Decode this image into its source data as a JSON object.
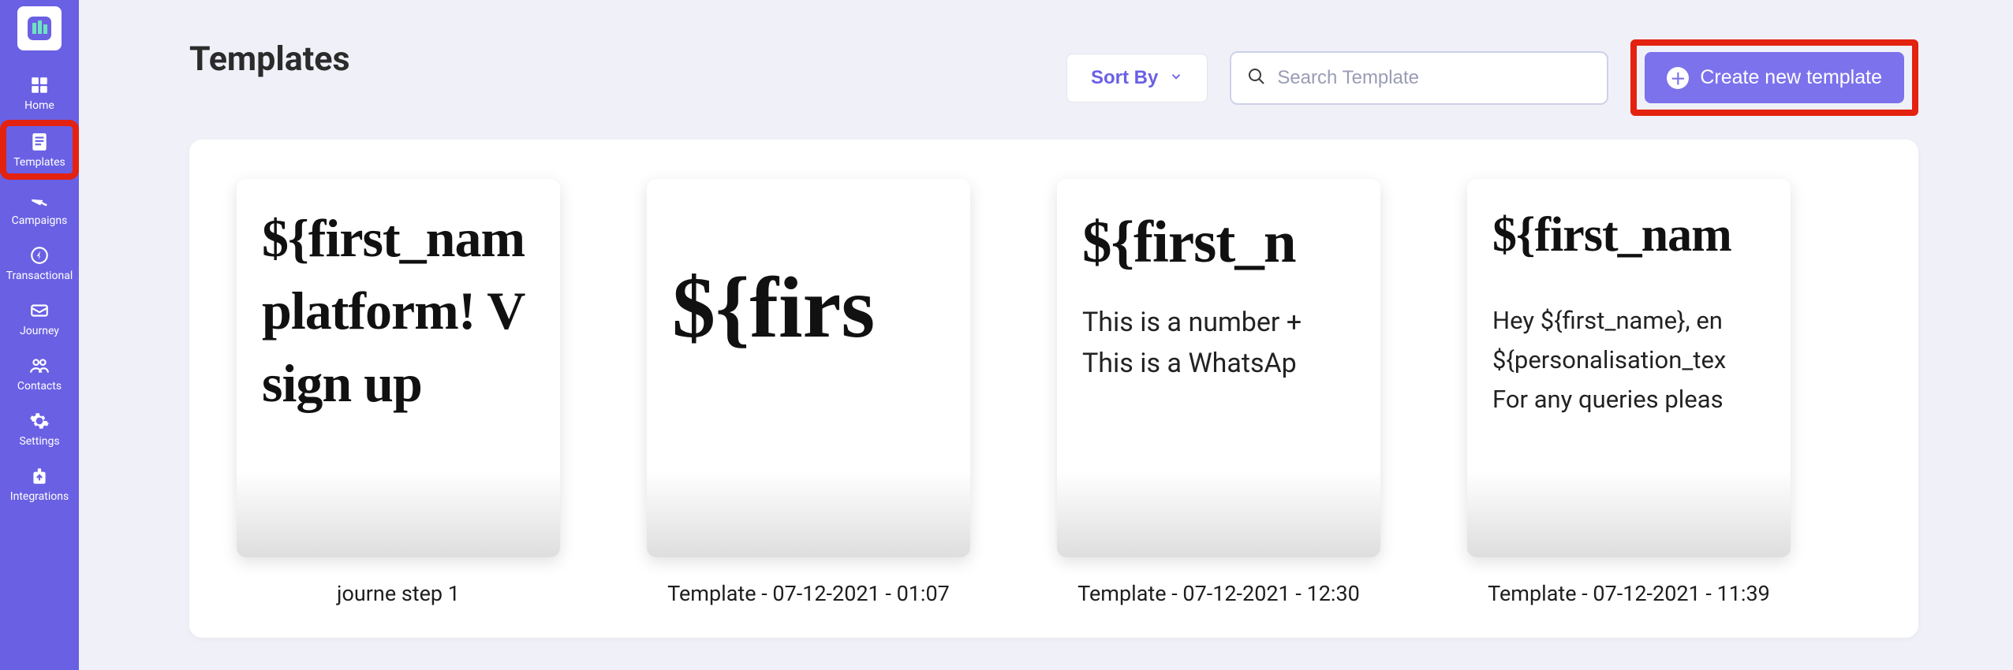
{
  "sidebar": {
    "items": [
      {
        "label": "Home"
      },
      {
        "label": "Templates"
      },
      {
        "label": "Campaigns"
      },
      {
        "label": "Transactional"
      },
      {
        "label": "Journey"
      },
      {
        "label": "Contacts"
      },
      {
        "label": "Settings"
      },
      {
        "label": "Integrations"
      }
    ]
  },
  "header": {
    "title": "Templates",
    "sort_label": "Sort By",
    "search_placeholder": "Search Template",
    "create_label": "Create new template"
  },
  "templates": [
    {
      "preview_line1": "${first_nam",
      "preview_line2": "platform! V",
      "preview_line3": "sign up",
      "title": "journe step 1",
      "variant": "a"
    },
    {
      "preview_line1": "${firs",
      "title": "Template - 07-12-2021 - 01:07",
      "variant": "b"
    },
    {
      "preview_line1": "${first_n",
      "preview_sub1": "This is a number +",
      "preview_sub2": "This is a WhatsAp",
      "title": "Template - 07-12-2021 - 12:30",
      "variant": "c"
    },
    {
      "preview_line1": "${first_nam",
      "preview_sub1": "Hey ${first_name}, en",
      "preview_sub2": "${personalisation_tex",
      "preview_sub3": "For any queries pleas",
      "title": "Template - 07-12-2021 - 11:39",
      "variant": "d"
    }
  ]
}
